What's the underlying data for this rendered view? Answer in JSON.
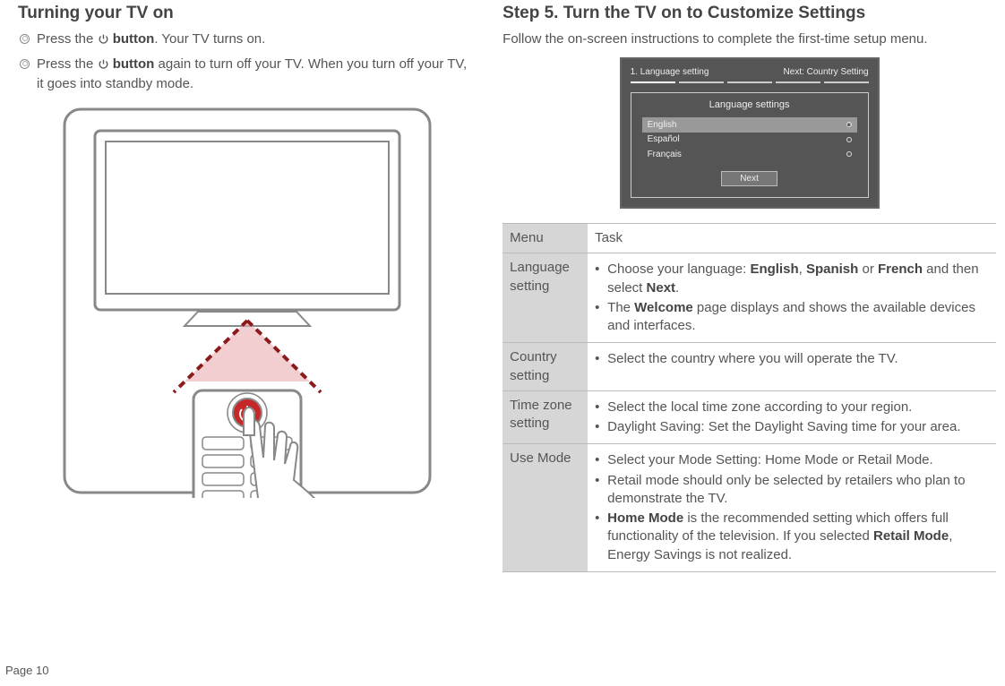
{
  "left": {
    "title": "Turning your TV on",
    "bullets": [
      {
        "pre": "Press the ",
        "bold": "button",
        "post": ". Your TV turns on."
      },
      {
        "pre": "Press the ",
        "bold": "button",
        "post": " again to turn off your TV. When you turn off your TV, it goes into standby mode."
      }
    ]
  },
  "right": {
    "title": "Step 5. Turn the TV on to Customize Settings",
    "intro": "Follow the on-screen instructions to complete the first-time setup menu.",
    "sim": {
      "step_label": "1. Language setting",
      "next_label": "Next: Country Setting",
      "box_title": "Language settings",
      "langs": [
        "English",
        "Español",
        "Français"
      ],
      "next_button": "Next"
    },
    "table": {
      "headers": {
        "menu": "Menu",
        "task": "Task"
      },
      "rows": [
        {
          "menu": "Language setting",
          "items": [
            {
              "text_pre": "Choose your language: ",
              "b1": "English",
              "mid1": ", ",
              "b2": "Spanish",
              "mid2": " or ",
              "b3": "French",
              "mid3": " and then select ",
              "b4": "Next",
              "post": "."
            },
            {
              "text_pre": "The ",
              "b1": "Welcome",
              "post": " page displays and shows the available devices and interfaces."
            }
          ]
        },
        {
          "menu": "Country setting",
          "items": [
            {
              "text_pre": "Select the country where you will operate the TV."
            }
          ]
        },
        {
          "menu": "Time zone setting",
          "items": [
            {
              "text_pre": "Select the local time zone according to your region."
            },
            {
              "text_pre": "Daylight Saving: Set the Daylight Saving time for your area."
            }
          ]
        },
        {
          "menu": "Use Mode",
          "items": [
            {
              "text_pre": "Select your Mode Setting: Home Mode or Retail Mode."
            },
            {
              "text_pre": "Retail mode should only be selected by retailers who plan to demonstrate the TV."
            },
            {
              "b1": "Home Mode",
              "mid1": " is the recommended setting which offers full functionality of the television. If you selected ",
              "b2": "Retail Mode",
              "post": ", Energy Savings is not realized."
            }
          ]
        }
      ]
    }
  },
  "page_number": "Page 10"
}
